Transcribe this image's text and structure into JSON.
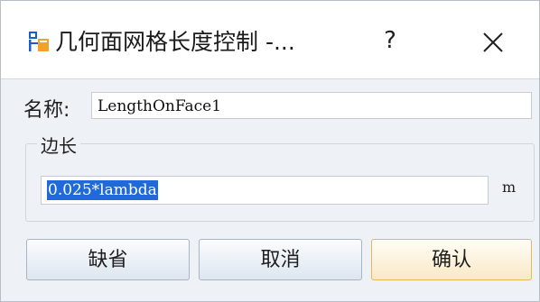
{
  "window": {
    "title": "几何面网格长度控制 -...",
    "help_glyph": "?",
    "close_glyph": "✕",
    "app_icon": "hierarchy-icon",
    "close_icon": "close-icon"
  },
  "form": {
    "name_label": "名称:",
    "name_value": "LengthOnFace1",
    "group_label": "边长",
    "edge_length_value": "0.025*lambda",
    "unit": "m"
  },
  "buttons": {
    "default_label": "缺省",
    "cancel_label": "取消",
    "ok_label": "确认"
  },
  "colors": {
    "selection": "#1f6ad8",
    "primary_border": "#e6b75f",
    "icon_blue": "#1a5fc8",
    "icon_orange": "#f2a12b"
  }
}
